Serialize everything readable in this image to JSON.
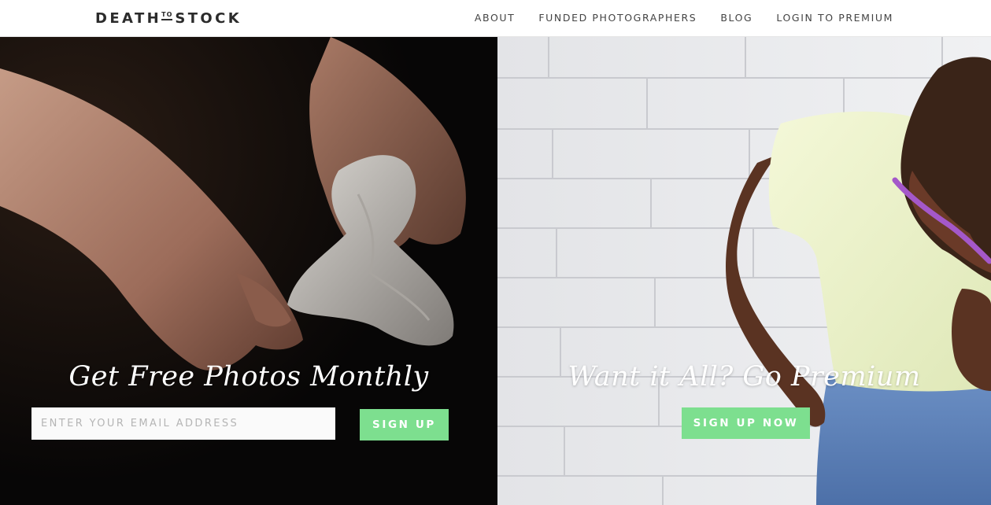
{
  "header": {
    "logo": {
      "word1": "DEATH",
      "connector": "TO",
      "word2": "STOCK"
    },
    "nav": [
      {
        "label": "ABOUT"
      },
      {
        "label": "FUNDED PHOTOGRAPHERS"
      },
      {
        "label": "BLOG"
      },
      {
        "label": "LOGIN TO PREMIUM"
      }
    ]
  },
  "free_panel": {
    "headline": "Get Free Photos Monthly",
    "email_placeholder": "ENTER YOUR EMAIL ADDRESS",
    "email_value": "",
    "button_label": "SIGN UP"
  },
  "premium_panel": {
    "headline": "Want it All? Go Premium",
    "button_label": "SIGN UP NOW"
  },
  "colors": {
    "accent_green": "#7ddf8f",
    "header_text": "#2b2b2b",
    "left_panel_bg": "#0b0a09",
    "right_panel_bg": "#e9eaec"
  }
}
